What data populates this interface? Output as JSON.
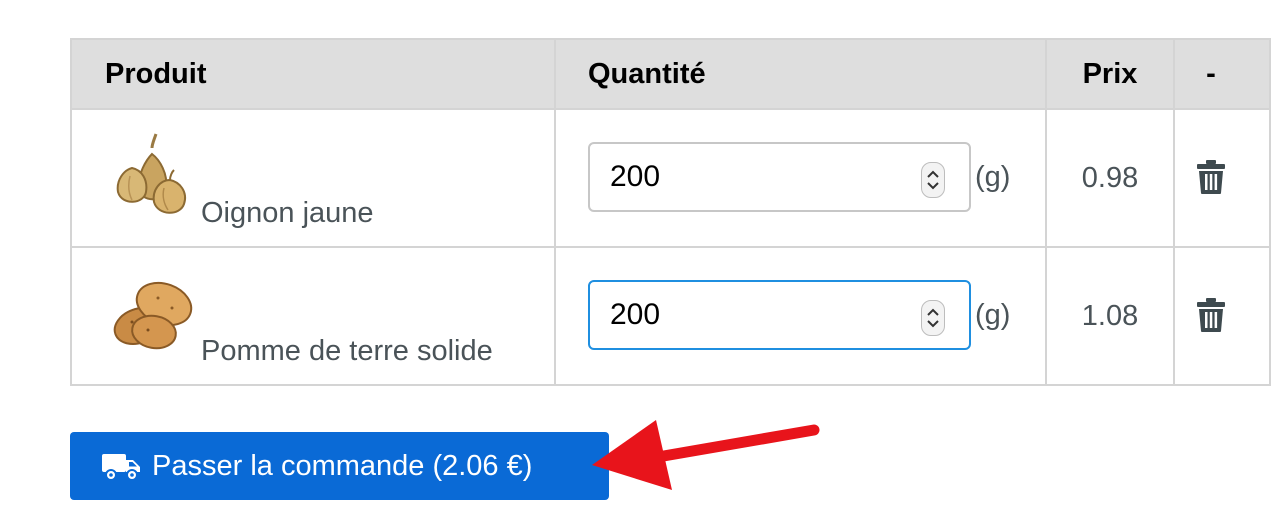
{
  "table": {
    "headers": {
      "product": "Produit",
      "quantity": "Quantité",
      "price": "Prix",
      "remove": "-"
    },
    "rows": [
      {
        "product": "Oignon jaune",
        "quantity": "200",
        "unit": "(g)",
        "price": "0.98",
        "image": "onion-image",
        "focused": false
      },
      {
        "product": "Pomme de terre solide",
        "quantity": "200",
        "unit": "(g)",
        "price": "1.08",
        "image": "potato-image",
        "focused": true
      }
    ]
  },
  "order_button": {
    "label": "Passer la commande (2.06 €)",
    "icon": "truck-icon"
  },
  "colors": {
    "button": "#0a6ad6",
    "header_bg": "#dedede",
    "focus_border": "#1f8fe0",
    "annotation_arrow": "#e8141b"
  }
}
